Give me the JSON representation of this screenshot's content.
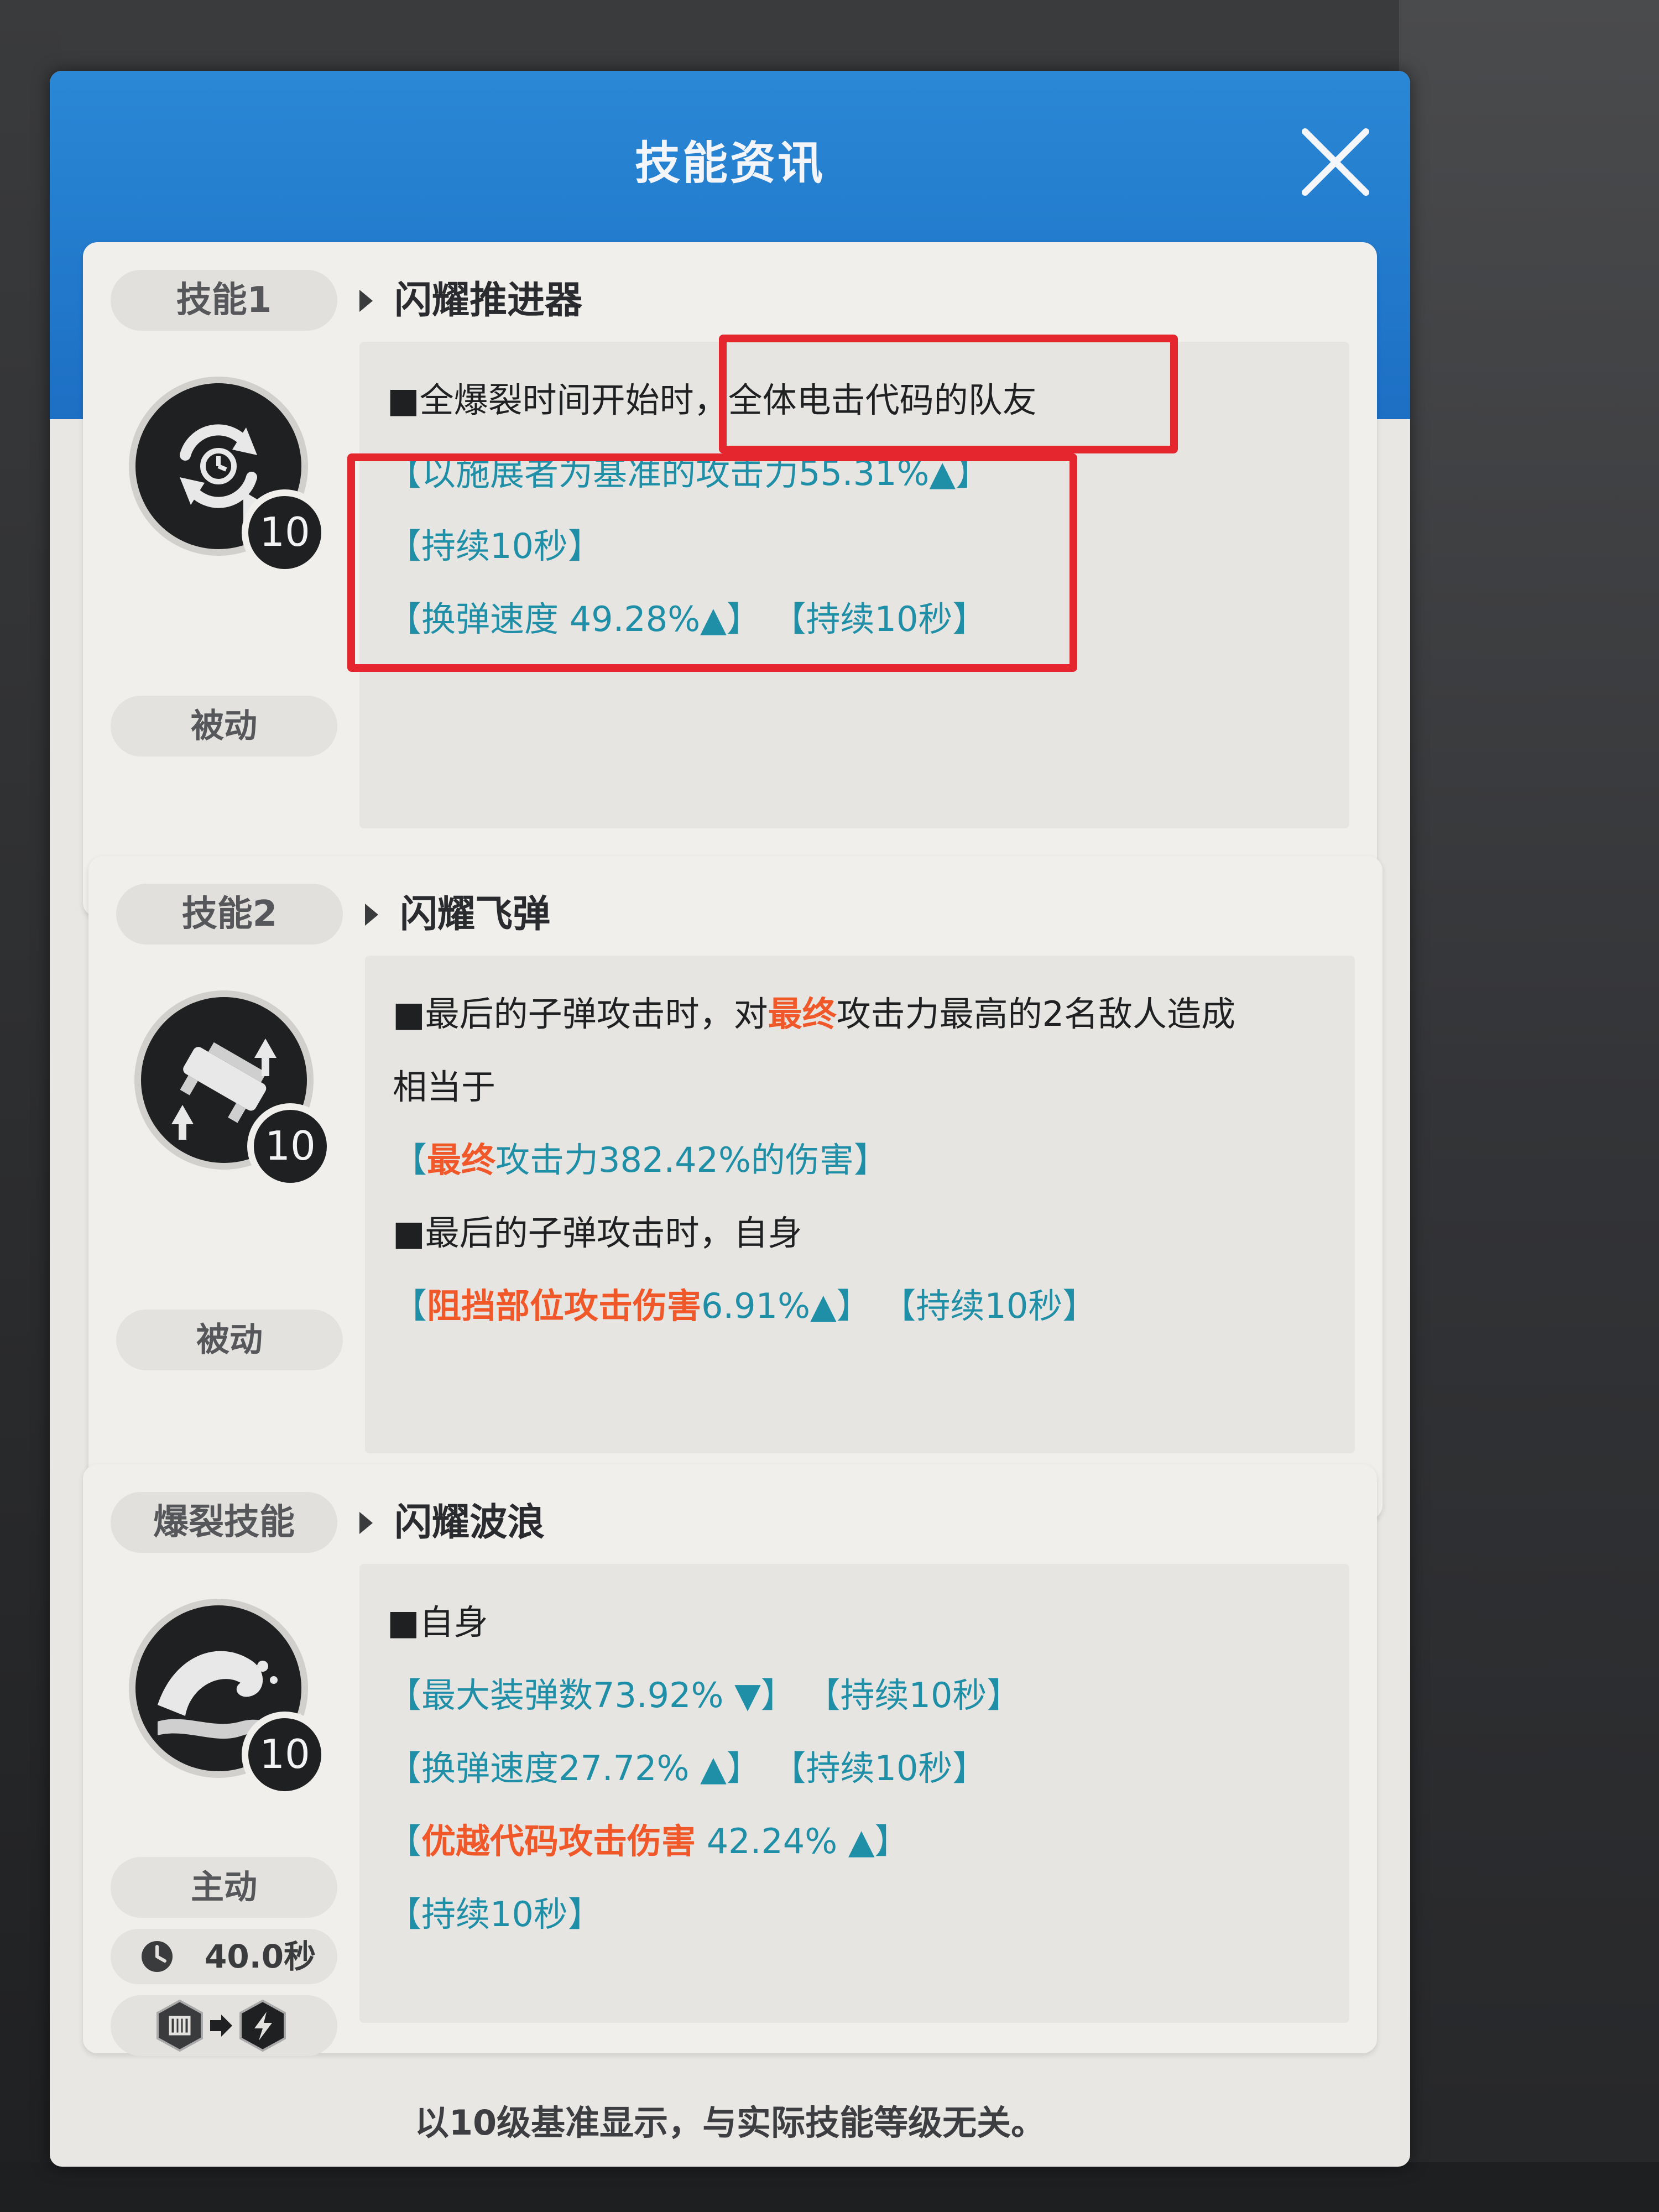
{
  "header": {
    "title": "技能资讯"
  },
  "skills": [
    {
      "tab": "技能1",
      "name": "闪耀推进器",
      "level": "10",
      "type": "被动",
      "line1_prefix": "■全爆裂时间开始时，",
      "line1_highlight": "全体电击代码的队友",
      "line2": "【以施展者为基准的攻击力55.31%▲】",
      "line3": "【持续10秒】",
      "line4": "【换弹速度 49.28%▲】 【持续10秒】"
    },
    {
      "tab": "技能2",
      "name": "闪耀飞弹",
      "level": "10",
      "type": "被动",
      "line1_a": "■最后的子弹攻击时，对",
      "line1_b": "最终",
      "line1_c": "攻击力最高的2名敌人造成",
      "line2": "相当于",
      "line3_a": "【",
      "line3_b": "最终",
      "line3_c": "攻击力382.42%的伤害】",
      "line4": "■最后的子弹攻击时，自身",
      "line5_a": "【",
      "line5_b": "阻挡部位攻击伤害",
      "line5_c": "6.91%▲】 【持续10秒】"
    },
    {
      "tab": "爆裂技能",
      "name": "闪耀波浪",
      "level": "10",
      "type": "主动",
      "cooldown": "40.0秒",
      "line1": "■自身",
      "line2": "【最大装弹数73.92% ▼】 【持续10秒】",
      "line3": "【换弹速度27.72% ▲】 【持续10秒】",
      "line4_a": "【",
      "line4_b": "优越代码攻击伤害",
      "line4_c": " 42.24% ▲】",
      "line5": "【持续10秒】"
    }
  ],
  "footer": "以10级基准显示，与实际技能等级无关。",
  "colors": {
    "header_blue": "#1d6fc4",
    "teal_text": "#1f8fa7",
    "orange_text": "#f0582a",
    "annotation_red": "#e5262f"
  }
}
